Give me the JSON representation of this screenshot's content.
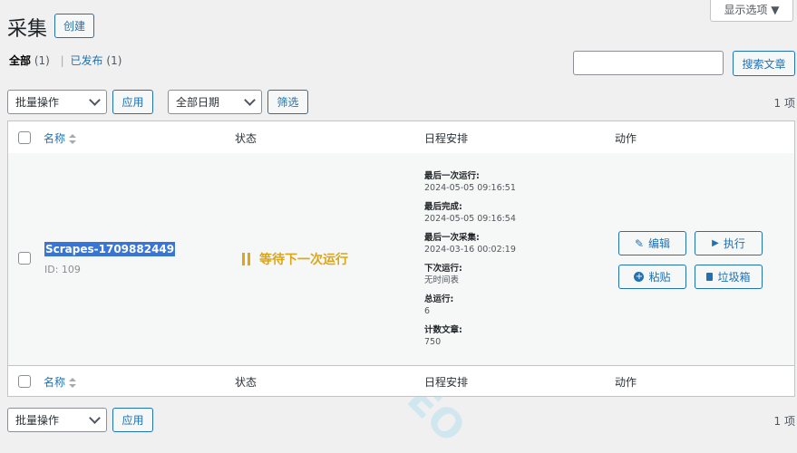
{
  "header": {
    "title": "采集",
    "create_label": "创建",
    "screen_options_label": "显示选项 ▼"
  },
  "filters": {
    "all_label": "全部",
    "all_count": "(1)",
    "separator": "|",
    "published_label": "已发布",
    "published_count": "(1)"
  },
  "search": {
    "placeholder": "",
    "button_label": "搜索文章"
  },
  "bulk_top": {
    "select_value": "批量操作",
    "apply_label": "应用",
    "date_value": "全部日期",
    "filter_label": "筛选",
    "count": "1 项"
  },
  "bulk_bottom": {
    "select_value": "批量操作",
    "apply_label": "应用",
    "count": "1 项"
  },
  "columns": {
    "name": "名称",
    "status": "状态",
    "schedule": "日程安排",
    "actions": "动作"
  },
  "row": {
    "title": "Scrapes-1709882449",
    "id": "ID: 109",
    "status_icon": "pause-icon",
    "status_text": "等待下一次运行",
    "status_color": "#dba617",
    "schedule": [
      {
        "label": "最后一次运行:",
        "value": "2024-05-05 09:16:51"
      },
      {
        "label": "最后完成:",
        "value": "2024-05-05 09:16:54"
      },
      {
        "label": "最后一次采集:",
        "value": "2024-03-16 00:02:19"
      },
      {
        "label": "下次运行:",
        "value": "无时间表"
      },
      {
        "label": "总运行:",
        "value": "6"
      },
      {
        "label": "计数文章:",
        "value": "750"
      }
    ],
    "actions": {
      "edit": "编辑",
      "run": "执行",
      "paste": "粘贴",
      "trash": "垃圾箱"
    }
  },
  "colors": {
    "accent": "#2271b1",
    "highlight": "#3875d7"
  }
}
